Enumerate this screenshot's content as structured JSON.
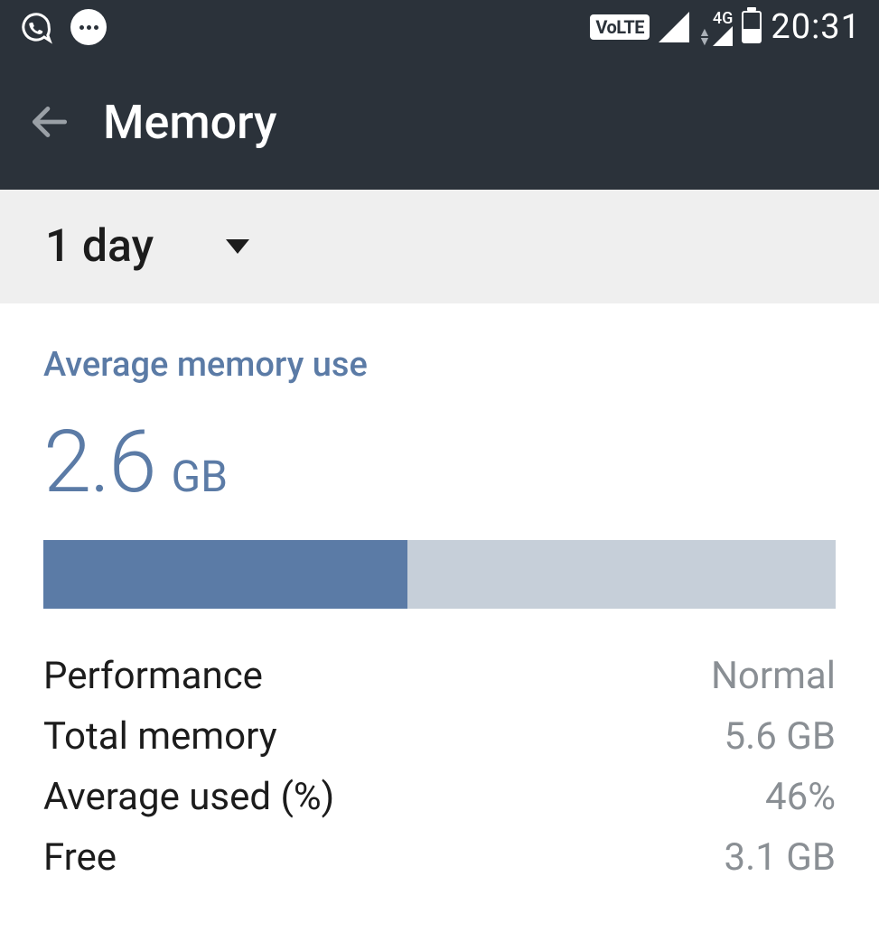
{
  "status_bar": {
    "volte_text": "VoLTE",
    "network_label": "4G",
    "battery_percent": 45,
    "time": "20:31"
  },
  "header": {
    "title": "Memory"
  },
  "dropdown": {
    "selected": "1 day"
  },
  "memory": {
    "section_title": "Average memory use",
    "average_value": "2.6",
    "average_unit": "GB",
    "progress_percent": 46,
    "stats": {
      "performance_label": "Performance",
      "performance_value": "Normal",
      "total_label": "Total memory",
      "total_value": "5.6 GB",
      "avg_pct_label": "Average used (%)",
      "avg_pct_value": "46%",
      "free_label": "Free",
      "free_value": "3.1 GB"
    }
  }
}
